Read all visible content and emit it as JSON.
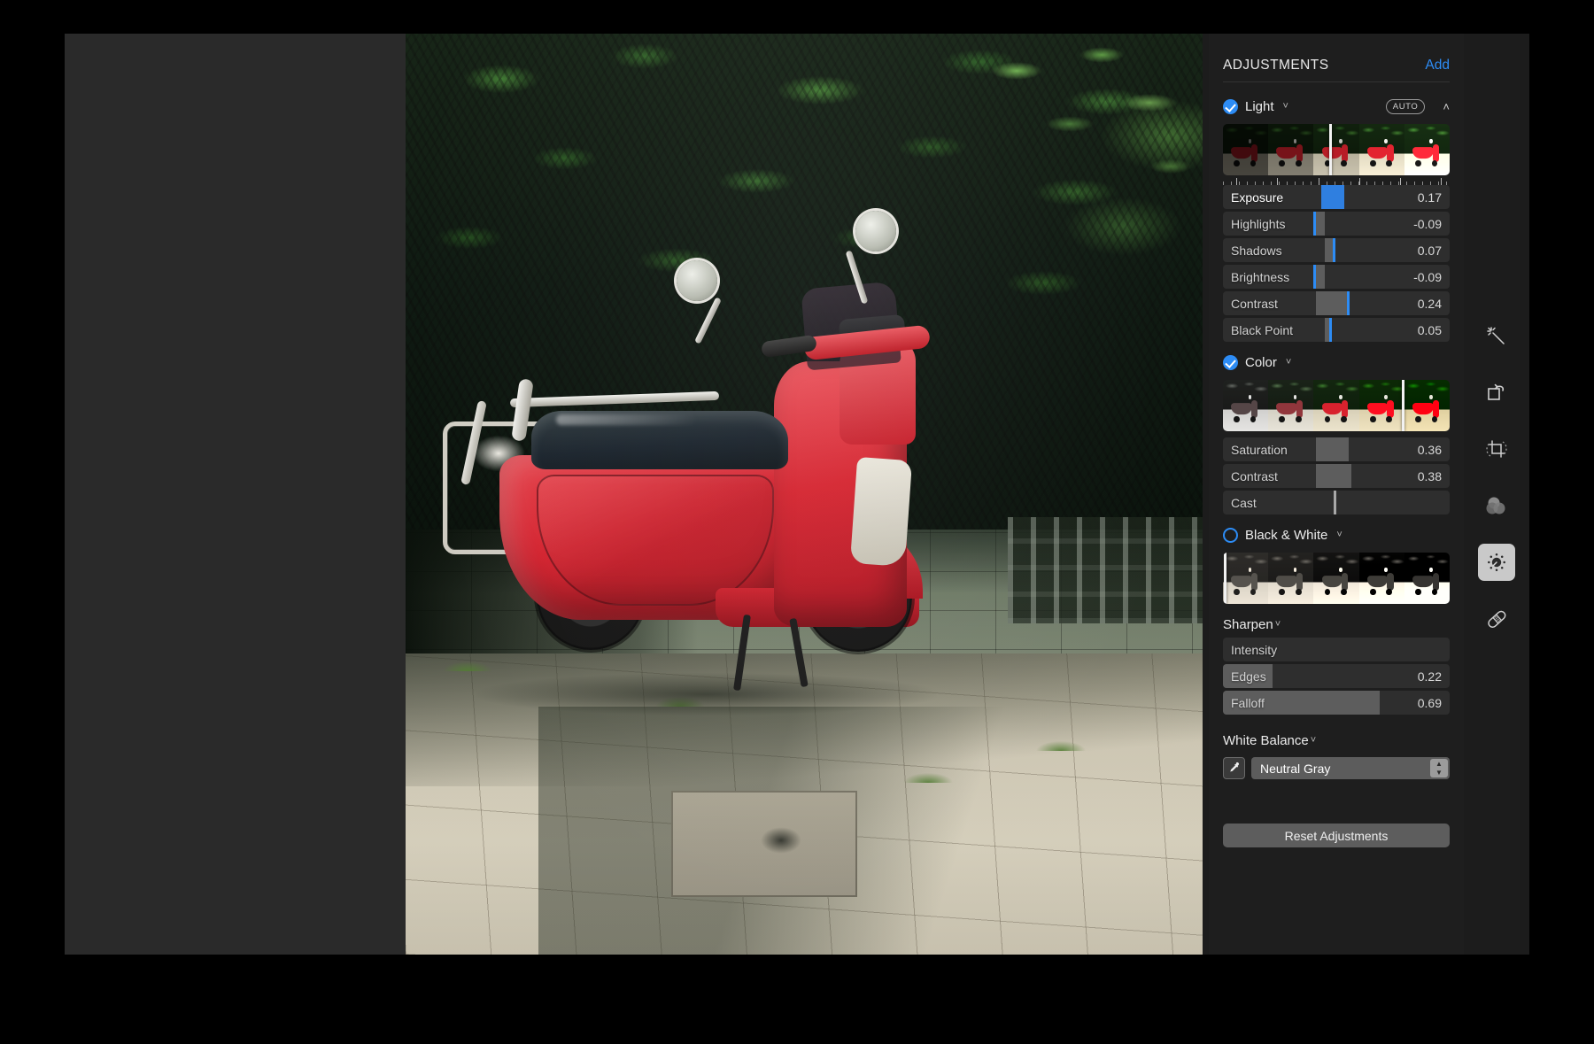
{
  "panel": {
    "title": "ADJUSTMENTS",
    "add_label": "Add",
    "reset_label": "Reset Adjustments"
  },
  "sections": {
    "light": {
      "name": "Light",
      "enabled": true,
      "auto_label": "AUTO",
      "caret": "˅",
      "collapse": "˄",
      "sliders": [
        {
          "label": "Exposure",
          "value": "0.17",
          "active": true
        },
        {
          "label": "Highlights",
          "value": "-0.09",
          "active": false
        },
        {
          "label": "Shadows",
          "value": "0.07",
          "active": false
        },
        {
          "label": "Brightness",
          "value": "-0.09",
          "active": false
        },
        {
          "label": "Contrast",
          "value": "0.24",
          "active": false
        },
        {
          "label": "Black Point",
          "value": "0.05",
          "active": false
        }
      ]
    },
    "color": {
      "name": "Color",
      "enabled": true,
      "caret": "˅",
      "sliders": [
        {
          "label": "Saturation",
          "value": "0.36"
        },
        {
          "label": "Contrast",
          "value": "0.38"
        },
        {
          "label": "Cast",
          "value": ""
        }
      ]
    },
    "black_white": {
      "name": "Black & White",
      "enabled": false,
      "caret": "˅"
    },
    "sharpen": {
      "name": "Sharpen",
      "caret": "˅",
      "sliders": [
        {
          "label": "Intensity",
          "value": ""
        },
        {
          "label": "Edges",
          "value": "0.22"
        },
        {
          "label": "Falloff",
          "value": "0.69"
        }
      ]
    },
    "white_balance": {
      "name": "White Balance",
      "caret": "˅",
      "mode": "Neutral Gray",
      "eyedropper_icon": "eyedropper-icon",
      "stepper_up": "▲",
      "stepper_down": "▼"
    }
  },
  "tools": [
    {
      "name": "auto-enhance-icon",
      "selected": false
    },
    {
      "name": "rotate-icon",
      "selected": false
    },
    {
      "name": "crop-icon",
      "selected": false
    },
    {
      "name": "filters-icon",
      "selected": false
    },
    {
      "name": "adjust-icon",
      "selected": true
    },
    {
      "name": "retouch-icon",
      "selected": false
    }
  ],
  "colors": {
    "accent": "#2d8cf5",
    "panel_bg": "#1e1e1e",
    "slider_bg": "#2e2e2e",
    "slider_fill": "#5d5d5d",
    "canvas_bg": "#2a2a2a"
  },
  "photo": {
    "subject": "red scooter parked on paving stones in front of foliage and a concrete block wall"
  }
}
